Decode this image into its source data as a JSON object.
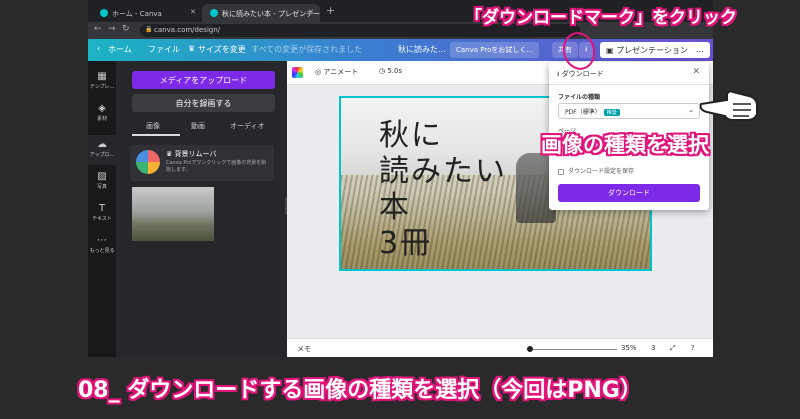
{
  "browser": {
    "tabs": [
      {
        "label": "ホーム - Canva"
      },
      {
        "label": "秋に読みたい本 - プレゼンテーション"
      }
    ],
    "new_tab": "+",
    "url": "canva.com/design/"
  },
  "toolbar": {
    "home": "ホーム",
    "file": "ファイル",
    "resize": "サイズを変更",
    "save_status": "すべての変更が保存されました",
    "doc_title": "秋に読みた...",
    "canva_pro": "Canva Proをお試しく...",
    "share": "共有",
    "present": "プレゼンテーション",
    "more": "..."
  },
  "rail": {
    "items": [
      {
        "label": "テンプレ..."
      },
      {
        "label": "素材"
      },
      {
        "label": "アップロ..."
      },
      {
        "label": "写真"
      },
      {
        "label": "テキスト"
      },
      {
        "label": "もっと見る"
      }
    ]
  },
  "panel": {
    "upload_button": "メディアをアップロード",
    "record_button": "自分を録画する",
    "tabs": [
      "画像",
      "動画",
      "オーディオ"
    ],
    "promo_title": "背景リムーバ",
    "promo_desc": "Canva Proでワンクリックで画像の背景を削除します。"
  },
  "context_bar": {
    "animate": "アニメート",
    "duration": "5.0s"
  },
  "design": {
    "lines": [
      "秋に",
      "読みたい",
      "本",
      "3冊"
    ]
  },
  "footer": {
    "notes": "メモ",
    "zoom": "35%",
    "page": "3"
  },
  "download": {
    "heading": "ダウンロード",
    "file_type_label": "ファイルの種類",
    "file_type_value": "PDF（標準）",
    "badge": "推奨",
    "size_label": "ページ",
    "save_settings": "ダウンロード設定を保存",
    "button": "ダウンロード"
  },
  "annotations": {
    "top": "「ダウンロードマーク」をクリック",
    "middle": "画像の種類を選択",
    "bottom": "08_ ダウンロードする画像の種類を選択（今回はPNG）"
  },
  "colors": {
    "accent": "#7d2ae8",
    "teal": "#00c4cc",
    "annotation": "#e0147a"
  }
}
